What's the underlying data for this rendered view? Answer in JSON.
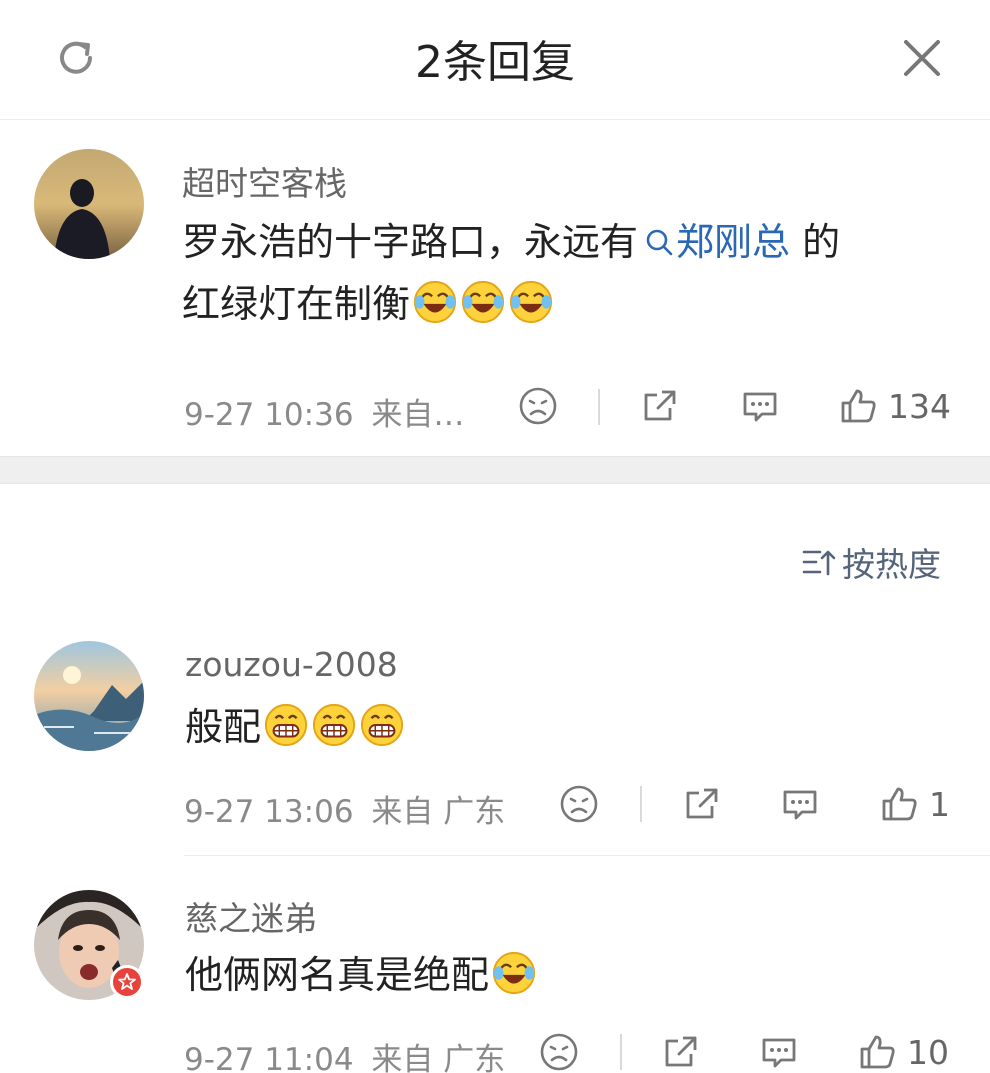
{
  "header": {
    "title": "2条回复",
    "refresh_icon": "refresh-icon",
    "close_icon": "close-icon"
  },
  "post": {
    "author": "超时空客栈",
    "text_before": "罗永浩的十字路口，永远有",
    "topic": "郑刚总",
    "text_after": " 的",
    "text_line2": "红绿灯在制衡",
    "emojis": [
      "laugh-cry-emoji",
      "laugh-cry-emoji",
      "laugh-cry-emoji"
    ],
    "timestamp": "9-27 10:36",
    "source": "来自…",
    "likes": "134"
  },
  "sort": {
    "label": "按热度",
    "icon": "sort-icon"
  },
  "replies": [
    {
      "author": "zouzou-2008",
      "text": "般配",
      "emojis": [
        "grin-emoji",
        "grin-emoji",
        "grin-emoji"
      ],
      "timestamp": "9-27 13:06",
      "source": "来自 广东",
      "likes": "1"
    },
    {
      "author": "慈之迷弟",
      "text": "他俩网名真是绝配",
      "emojis": [
        "laugh-cry-emoji"
      ],
      "timestamp": "9-27 11:04",
      "source": "来自 广东",
      "likes": "10"
    }
  ],
  "colors": {
    "topic_link": "#2a67b4",
    "meta_text": "#8a8a8a",
    "badge": "#e8423c"
  }
}
